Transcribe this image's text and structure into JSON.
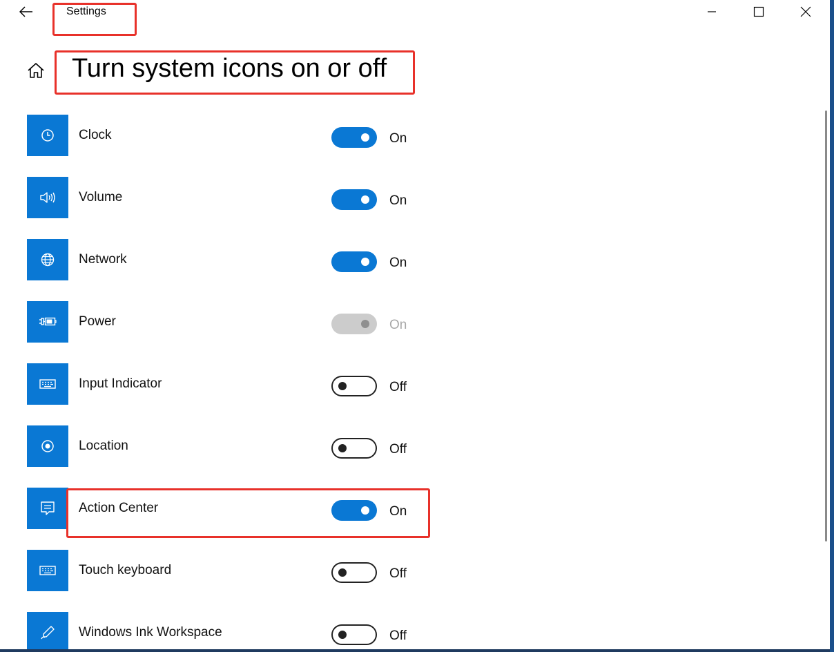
{
  "window": {
    "title": "Settings"
  },
  "header": {
    "page_title": "Turn system icons on or off"
  },
  "items": [
    {
      "label": "Clock",
      "state": "On",
      "icon": "clock-icon",
      "enabled": true
    },
    {
      "label": "Volume",
      "state": "On",
      "icon": "volume-icon",
      "enabled": true
    },
    {
      "label": "Network",
      "state": "On",
      "icon": "network-icon",
      "enabled": true
    },
    {
      "label": "Power",
      "state": "On",
      "icon": "power-icon",
      "enabled": false
    },
    {
      "label": "Input Indicator",
      "state": "Off",
      "icon": "keyboard-icon",
      "enabled": true
    },
    {
      "label": "Location",
      "state": "Off",
      "icon": "location-icon",
      "enabled": true
    },
    {
      "label": "Action Center",
      "state": "On",
      "icon": "action-center-icon",
      "enabled": true
    },
    {
      "label": "Touch keyboard",
      "state": "Off",
      "icon": "touch-keyboard-icon",
      "enabled": true
    },
    {
      "label": "Windows Ink Workspace",
      "state": "Off",
      "icon": "pen-icon",
      "enabled": true
    }
  ],
  "colors": {
    "accent": "#0a78d4",
    "annotation": "#e8312a",
    "disabled_track": "#cccccc",
    "disabled_text": "#a8a8a8"
  }
}
